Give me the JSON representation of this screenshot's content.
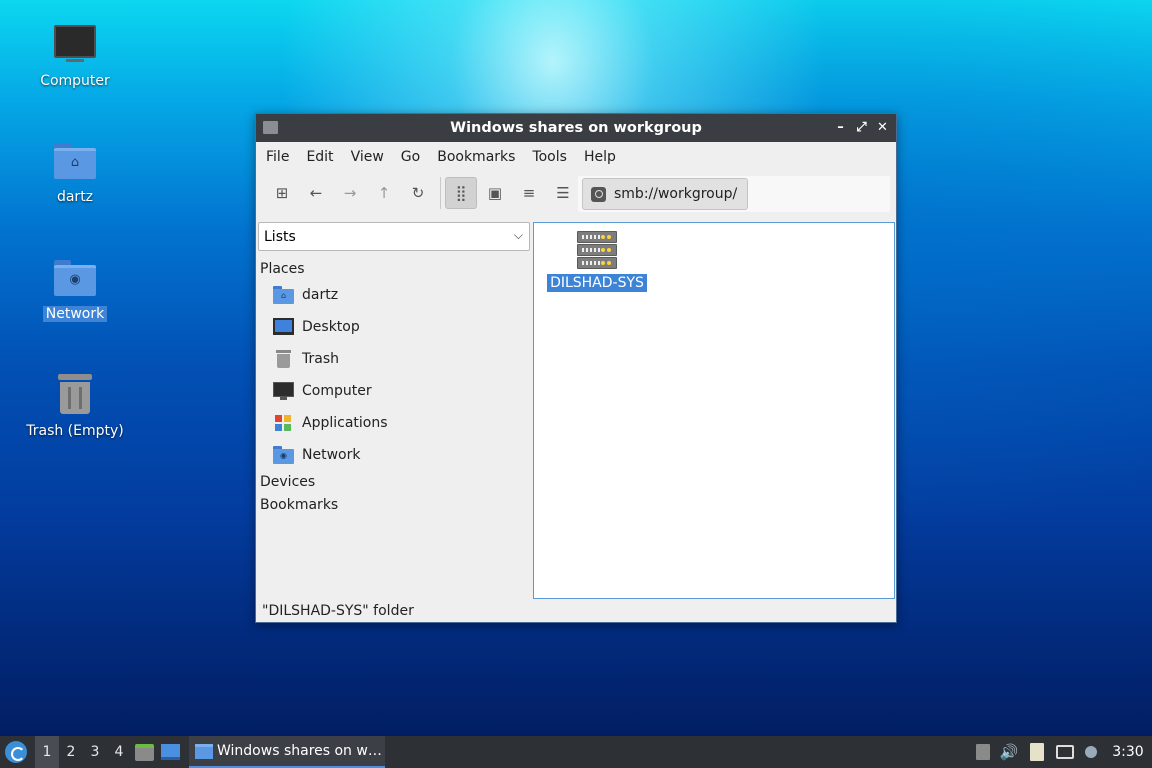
{
  "desktop": {
    "icons": [
      {
        "label": "Computer",
        "icon": "computer-icon"
      },
      {
        "label": "dartz",
        "icon": "home-folder-icon"
      },
      {
        "label": "Network",
        "icon": "network-folder-icon",
        "selected": true
      },
      {
        "label": "Trash (Empty)",
        "icon": "trash-icon"
      }
    ]
  },
  "window": {
    "title": "Windows shares on workgroup",
    "controls": {
      "minimize": "–",
      "maximize": "⤢",
      "close": "✕"
    },
    "menu": [
      "File",
      "Edit",
      "View",
      "Go",
      "Bookmarks",
      "Tools",
      "Help"
    ],
    "toolbar": {
      "new_tab": "⊞",
      "back": "←",
      "forward": "→",
      "up": "↑",
      "reload": "↻",
      "icon_view": "⣿",
      "thumbnail_view": "▣",
      "compact_view": "≡",
      "detailed_view": "☰",
      "location": "smb://workgroup/"
    },
    "sidepane": {
      "mode": "Lists",
      "places_heading": "Places",
      "places": [
        "dartz",
        "Desktop",
        "Trash",
        "Computer",
        "Applications",
        "Network"
      ],
      "devices_heading": "Devices",
      "bookmarks_heading": "Bookmarks"
    },
    "content": {
      "items": [
        {
          "label": "DILSHAD-SYS",
          "icon": "server-icon",
          "selected": true
        }
      ]
    },
    "status": "\"DILSHAD-SYS\" folder"
  },
  "taskbar": {
    "workspaces": [
      "1",
      "2",
      "3",
      "4"
    ],
    "active_workspace": "1",
    "task_label": "Windows shares on w…",
    "clock": "3:30",
    "volume_icon": "🔊"
  },
  "colors": {
    "selection": "#3d84d6",
    "titlebar": "#3a3d41",
    "taskbar": "#2d3035",
    "folder": "#5a98e3"
  }
}
